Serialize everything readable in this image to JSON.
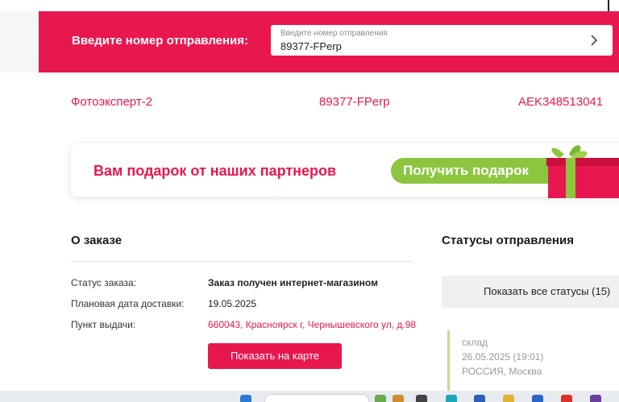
{
  "search": {
    "label": "Введите номер отправления:",
    "placeholder": "Введите номер отправления",
    "value": "89377-FPerp"
  },
  "refs": {
    "store": "Фотоэксперт-2",
    "order_number": "89377-FPerp",
    "tracking_number": "AEK348513041"
  },
  "promo": {
    "title": "Вам подарок от наших партнеров",
    "button": "Получить подарок"
  },
  "order": {
    "title": "О заказе",
    "rows": [
      {
        "label": "Статус заказа:",
        "value": "Заказ получен интернет-магазином"
      },
      {
        "label": "Плановая дата доставки:",
        "value": "19.05.2025"
      },
      {
        "label": "Пункт выдачи:",
        "value": "660043, Красноярск г, Чернышевского ул, д.98"
      }
    ],
    "map_button": "Показать на карте"
  },
  "statuses": {
    "title": "Статусы отправления",
    "show_all": "Показать все статусы (15)",
    "last": {
      "line1": "склад",
      "date": "26.05.2025 (19:01)",
      "place": "РОССИЯ, Москва"
    }
  },
  "colors": {
    "accent": "#e8174f",
    "promo_button": "#8cc63f"
  }
}
